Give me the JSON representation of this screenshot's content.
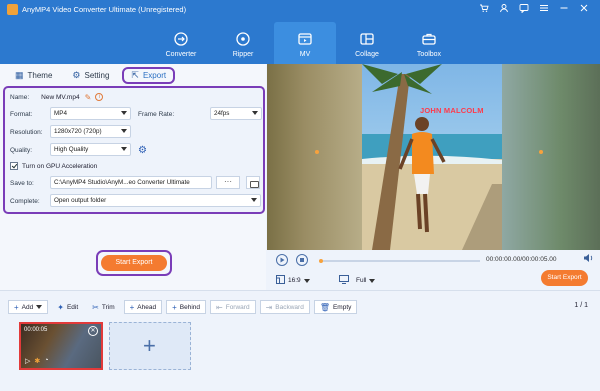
{
  "app": {
    "title": "AnyMP4 Video Converter Ultimate (Unregistered)"
  },
  "window_controls": [
    "cart-icon",
    "user-icon",
    "feedback-icon",
    "menu-icon",
    "minimize-icon",
    "close-icon"
  ],
  "main_tabs": [
    {
      "label": "Converter",
      "icon": "converter-icon",
      "active": false
    },
    {
      "label": "Ripper",
      "icon": "ripper-icon",
      "active": false
    },
    {
      "label": "MV",
      "icon": "mv-icon",
      "active": true
    },
    {
      "label": "Collage",
      "icon": "collage-icon",
      "active": false
    },
    {
      "label": "Toolbox",
      "icon": "toolbox-icon",
      "active": false
    }
  ],
  "sub_tabs": [
    {
      "label": "Theme",
      "icon": "theme-icon"
    },
    {
      "label": "Setting",
      "icon": "setting-icon"
    },
    {
      "label": "Export",
      "icon": "export-icon",
      "active": true
    }
  ],
  "export_settings": {
    "name_label": "Name:",
    "name_value": "New MV.mp4",
    "format_label": "Format:",
    "format_value": "MP4",
    "frame_rate_label": "Frame Rate:",
    "frame_rate_value": "24fps",
    "resolution_label": "Resolution:",
    "resolution_value": "1280x720 (720p)",
    "quality_label": "Quality:",
    "quality_value": "High Quality",
    "gpu_label": "Turn on GPU Acceleration",
    "gpu_checked": true,
    "save_to_label": "Save to:",
    "save_to_value": "C:\\AnyMP4 Studio\\AnyM...eo Converter Ultimate",
    "browse_label": "···",
    "complete_label": "Complete:",
    "complete_value": "Open output folder"
  },
  "start_export_label": "Start Export",
  "preview": {
    "overlay_text": "JOHN MALCOLM"
  },
  "player": {
    "time_text": "00:00:00.00/00:00:05.00",
    "ratio_value": "16:9",
    "view_value": "Full",
    "start_export_label": "Start Export",
    "progress": 0.0
  },
  "toolbar": {
    "add_label": "Add",
    "edit_label": "Edit",
    "trim_label": "Trim",
    "ahead_label": "Ahead",
    "behind_label": "Behind",
    "forward_label": "Forward",
    "backward_label": "Backward",
    "empty_label": "Empty",
    "pager": "1 / 1"
  },
  "clip": {
    "duration": "00:00:05"
  },
  "colors": {
    "header_blue": "#2c79cf",
    "accent_orange": "#f47b30",
    "highlight_purple": "#7a3db8"
  }
}
